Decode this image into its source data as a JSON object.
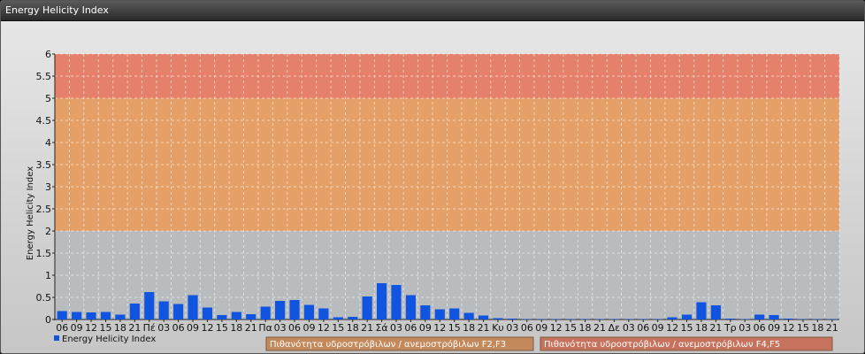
{
  "window": {
    "title": "Energy Helicity Index"
  },
  "colors": {
    "bar": "#1154e0",
    "band_low": "#b8bcbe",
    "band_mid": "#e4a066",
    "band_high": "#e5806a",
    "legend_box_f2f3": "#c4895a",
    "legend_box_f4f5": "#c7725d"
  },
  "chart_data": {
    "type": "bar",
    "ylabel": "Energy Helicity Index",
    "ylim": [
      0,
      6
    ],
    "yticks": [
      "0",
      "0.5",
      "1",
      "1.5",
      "2",
      "2.5",
      "3",
      "3.5",
      "4",
      "4.5",
      "5",
      "5.5",
      "6"
    ],
    "grid": true,
    "legend_position": "bottom-left",
    "categories": [
      "06",
      "09",
      "12",
      "15",
      "18",
      "21",
      "Πέ",
      "03",
      "06",
      "09",
      "12",
      "15",
      "18",
      "21",
      "Πα",
      "03",
      "06",
      "09",
      "12",
      "15",
      "18",
      "21",
      "Σά",
      "03",
      "06",
      "09",
      "12",
      "15",
      "18",
      "21",
      "Κυ",
      "03",
      "06",
      "09",
      "12",
      "15",
      "18",
      "21",
      "Δε",
      "03",
      "06",
      "09",
      "12",
      "15",
      "18",
      "21",
      "Τρ",
      "03",
      "06",
      "09",
      "12",
      "15",
      "18",
      "21"
    ],
    "series": [
      {
        "name": "Energy Helicity Index",
        "values": [
          0.19,
          0.17,
          0.16,
          0.17,
          0.11,
          0.36,
          0.62,
          0.41,
          0.35,
          0.55,
          0.27,
          0.1,
          0.17,
          0.12,
          0.29,
          0.42,
          0.44,
          0.33,
          0.25,
          0.05,
          0.06,
          0.52,
          0.82,
          0.78,
          0.55,
          0.32,
          0.23,
          0.25,
          0.15,
          0.09,
          0.03,
          0.02,
          0.01,
          0.01,
          0.01,
          0.01,
          0.01,
          0.01,
          0.01,
          0.01,
          0.01,
          0.01,
          0.05,
          0.11,
          0.39,
          0.32,
          0.02,
          0.01,
          0.11,
          0.1,
          0.02,
          0.01,
          0.01,
          0.01
        ]
      }
    ],
    "bands": [
      {
        "from": 0,
        "to": 2,
        "color_key": "band_low"
      },
      {
        "from": 2,
        "to": 5,
        "color_key": "band_mid"
      },
      {
        "from": 5,
        "to": 6,
        "color_key": "band_high"
      }
    ],
    "band_legend": [
      "Πιθανότητα υδροστρόβιλων / ανεμοστρόβιλων F2,F3",
      "Πιθανότητα υδροστρόβιλων / ανεμοστρόβιλων F4,F5"
    ]
  }
}
